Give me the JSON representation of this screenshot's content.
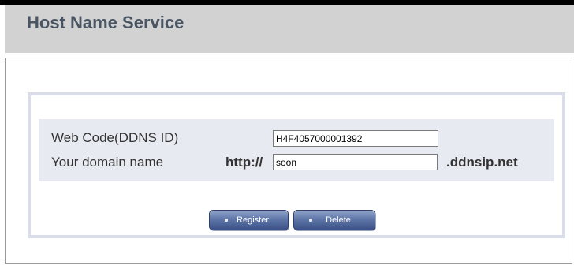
{
  "header": {
    "title": "Host Name Service"
  },
  "form": {
    "web_code_label": "Web Code(DDNS ID)",
    "web_code_value": "H4F4057000001392",
    "domain_label": "Your domain name",
    "domain_prefix": "http://",
    "domain_value": "soon",
    "domain_suffix": ".ddnsip.net"
  },
  "buttons": {
    "register_label": "Register",
    "delete_label": "Delete"
  },
  "colors": {
    "header_bg": "#d2d2d2",
    "title_text": "#4a5563",
    "form_band_bg": "#e8eaf1",
    "button_blue": "#5f77a8"
  }
}
